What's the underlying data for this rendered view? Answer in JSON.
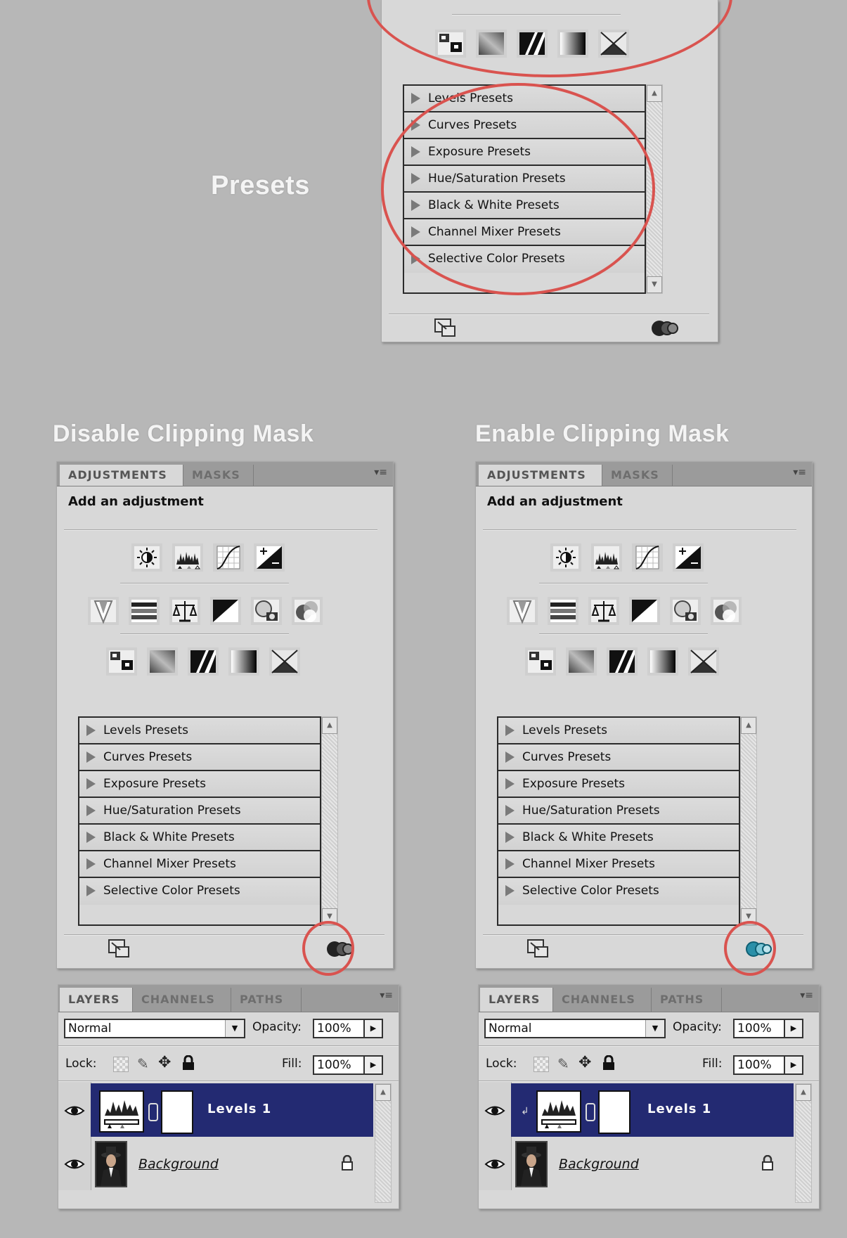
{
  "headings": {
    "presets": "Presets",
    "disable": "Disable Clipping Mask",
    "enable": "Enable Clipping Mask"
  },
  "adjustments_panel": {
    "tabs": [
      "ADJUSTMENTS",
      "MASKS"
    ],
    "title": "Add an adjustment",
    "icon_rows": [
      [
        "brightness-contrast-icon",
        "levels-icon",
        "curves-icon",
        "exposure-icon"
      ],
      [
        "vibrance-icon",
        "hue-saturation-icon",
        "color-balance-icon",
        "black-white-icon",
        "photo-filter-icon",
        "channel-mixer-icon"
      ],
      [
        "invert-icon",
        "posterize-icon",
        "threshold-icon",
        "gradient-map-icon",
        "selective-color-icon"
      ]
    ],
    "presets": [
      "Levels Presets",
      "Curves Presets",
      "Exposure Presets",
      "Hue/Saturation Presets",
      "Black & White Presets",
      "Channel Mixer Presets",
      "Selective Color Presets"
    ],
    "footer_icons": [
      "return-to-list-icon",
      "clip-to-layer-icon"
    ]
  },
  "layers_panel": {
    "tabs": [
      "LAYERS",
      "CHANNELS",
      "PATHS"
    ],
    "blend_mode": "Normal",
    "opacity_label": "Opacity:",
    "opacity_value": "100%",
    "lock_label": "Lock:",
    "fill_label": "Fill:",
    "fill_value": "100%",
    "layers": [
      {
        "name": "Levels 1",
        "selected": true
      },
      {
        "name": "Background",
        "selected": false
      }
    ]
  },
  "colors": {
    "annotation_circle": "#d9534f",
    "selected_layer": "#232a72",
    "clip_enabled_icon": "#2a8fa8"
  }
}
